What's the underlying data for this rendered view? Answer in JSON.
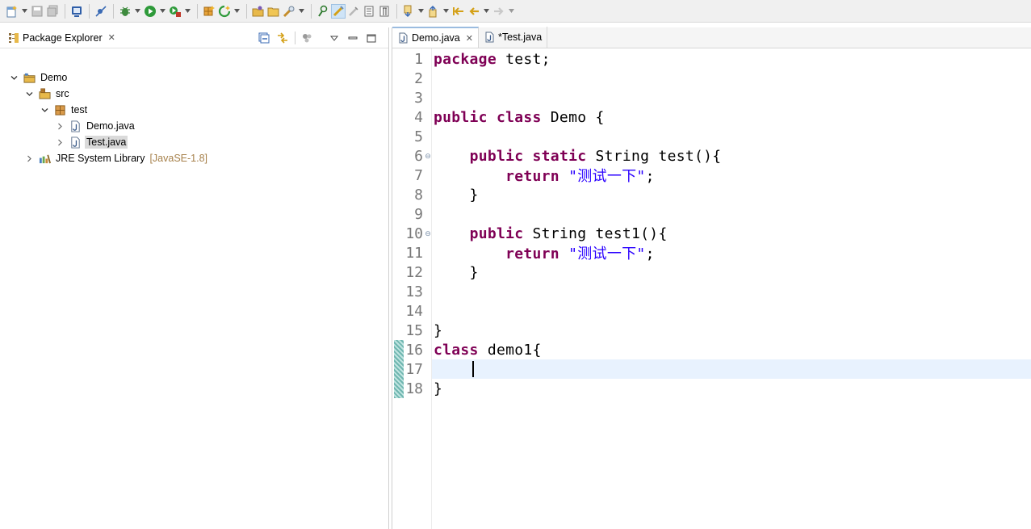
{
  "toolbar": {
    "items": [
      "new-icon",
      "save-icon",
      "save-all-icon",
      "console-icon",
      "skip-breakpoints-icon",
      "debug-icon",
      "run-icon",
      "external-tools-icon",
      "new-java-project-icon",
      "new-package-icon",
      "open-type-icon",
      "open-task-icon",
      "search-icon",
      "toggle-mark-occurrences-icon",
      "toggle-block-selection-icon",
      "show-whitespace-icon",
      "show-source-only-icon",
      "next-annotation-icon",
      "previous-annotation-icon",
      "last-edit-location-icon",
      "back-icon",
      "forward-icon"
    ]
  },
  "package_explorer": {
    "title": "Package Explorer",
    "close_glyph": "✕",
    "tree": [
      {
        "label": "Demo",
        "decor": "",
        "icon": "project-icon",
        "expanded": true,
        "selected": false
      },
      {
        "label": "src",
        "decor": "",
        "icon": "source-folder-icon",
        "expanded": true,
        "selected": false
      },
      {
        "label": "test",
        "decor": "",
        "icon": "package-icon",
        "expanded": true,
        "selected": false
      },
      {
        "label": "Demo.java",
        "decor": "",
        "icon": "java-file-icon",
        "expanded": false,
        "selected": false
      },
      {
        "label": "Test.java",
        "decor": "",
        "icon": "java-file-icon",
        "expanded": false,
        "selected": true
      },
      {
        "label": "JRE System Library",
        "decor": "[JavaSE-1.8]",
        "icon": "library-icon",
        "expanded": false,
        "selected": false
      }
    ]
  },
  "editor": {
    "tabs": [
      {
        "label": "Demo.java",
        "active": true,
        "close_glyph": "✕"
      },
      {
        "label": "*Test.java",
        "active": false,
        "close_glyph": ""
      }
    ],
    "current_line": 17,
    "lines": [
      {
        "n": "1",
        "fold": "",
        "tokens": [
          {
            "t": "package",
            "c": "kw"
          },
          {
            "t": " test;",
            "c": ""
          }
        ]
      },
      {
        "n": "2",
        "fold": "",
        "tokens": []
      },
      {
        "n": "3",
        "fold": "",
        "tokens": []
      },
      {
        "n": "4",
        "fold": "",
        "tokens": [
          {
            "t": "public",
            "c": "kw"
          },
          {
            "t": " ",
            "c": ""
          },
          {
            "t": "class",
            "c": "kw"
          },
          {
            "t": " Demo {",
            "c": ""
          }
        ]
      },
      {
        "n": "5",
        "fold": "",
        "tokens": []
      },
      {
        "n": "6",
        "fold": "⊖",
        "tokens": [
          {
            "t": "    ",
            "c": ""
          },
          {
            "t": "public",
            "c": "kw"
          },
          {
            "t": " ",
            "c": ""
          },
          {
            "t": "static",
            "c": "kw"
          },
          {
            "t": " String test(){",
            "c": ""
          }
        ]
      },
      {
        "n": "7",
        "fold": "",
        "tokens": [
          {
            "t": "        ",
            "c": ""
          },
          {
            "t": "return",
            "c": "kw"
          },
          {
            "t": " ",
            "c": ""
          },
          {
            "t": "\"测试一下\"",
            "c": "str"
          },
          {
            "t": ";",
            "c": ""
          }
        ]
      },
      {
        "n": "8",
        "fold": "",
        "tokens": [
          {
            "t": "    }",
            "c": ""
          }
        ]
      },
      {
        "n": "9",
        "fold": "",
        "tokens": []
      },
      {
        "n": "10",
        "fold": "⊖",
        "tokens": [
          {
            "t": "    ",
            "c": ""
          },
          {
            "t": "public",
            "c": "kw"
          },
          {
            "t": " String test1(){",
            "c": ""
          }
        ]
      },
      {
        "n": "11",
        "fold": "",
        "tokens": [
          {
            "t": "        ",
            "c": ""
          },
          {
            "t": "return",
            "c": "kw"
          },
          {
            "t": " ",
            "c": ""
          },
          {
            "t": "\"测试一下\"",
            "c": "str"
          },
          {
            "t": ";",
            "c": ""
          }
        ]
      },
      {
        "n": "12",
        "fold": "",
        "tokens": [
          {
            "t": "    }",
            "c": ""
          }
        ]
      },
      {
        "n": "13",
        "fold": "",
        "tokens": []
      },
      {
        "n": "14",
        "fold": "",
        "tokens": []
      },
      {
        "n": "15",
        "fold": "",
        "tokens": [
          {
            "t": "}",
            "c": ""
          }
        ]
      },
      {
        "n": "16",
        "fold": "",
        "tokens": [
          {
            "t": "class",
            "c": "kw"
          },
          {
            "t": " demo1{",
            "c": ""
          }
        ]
      },
      {
        "n": "17",
        "fold": "",
        "tokens": [
          {
            "t": "    ",
            "c": ""
          }
        ]
      },
      {
        "n": "18",
        "fold": "",
        "tokens": [
          {
            "t": "}",
            "c": ""
          }
        ]
      }
    ]
  }
}
